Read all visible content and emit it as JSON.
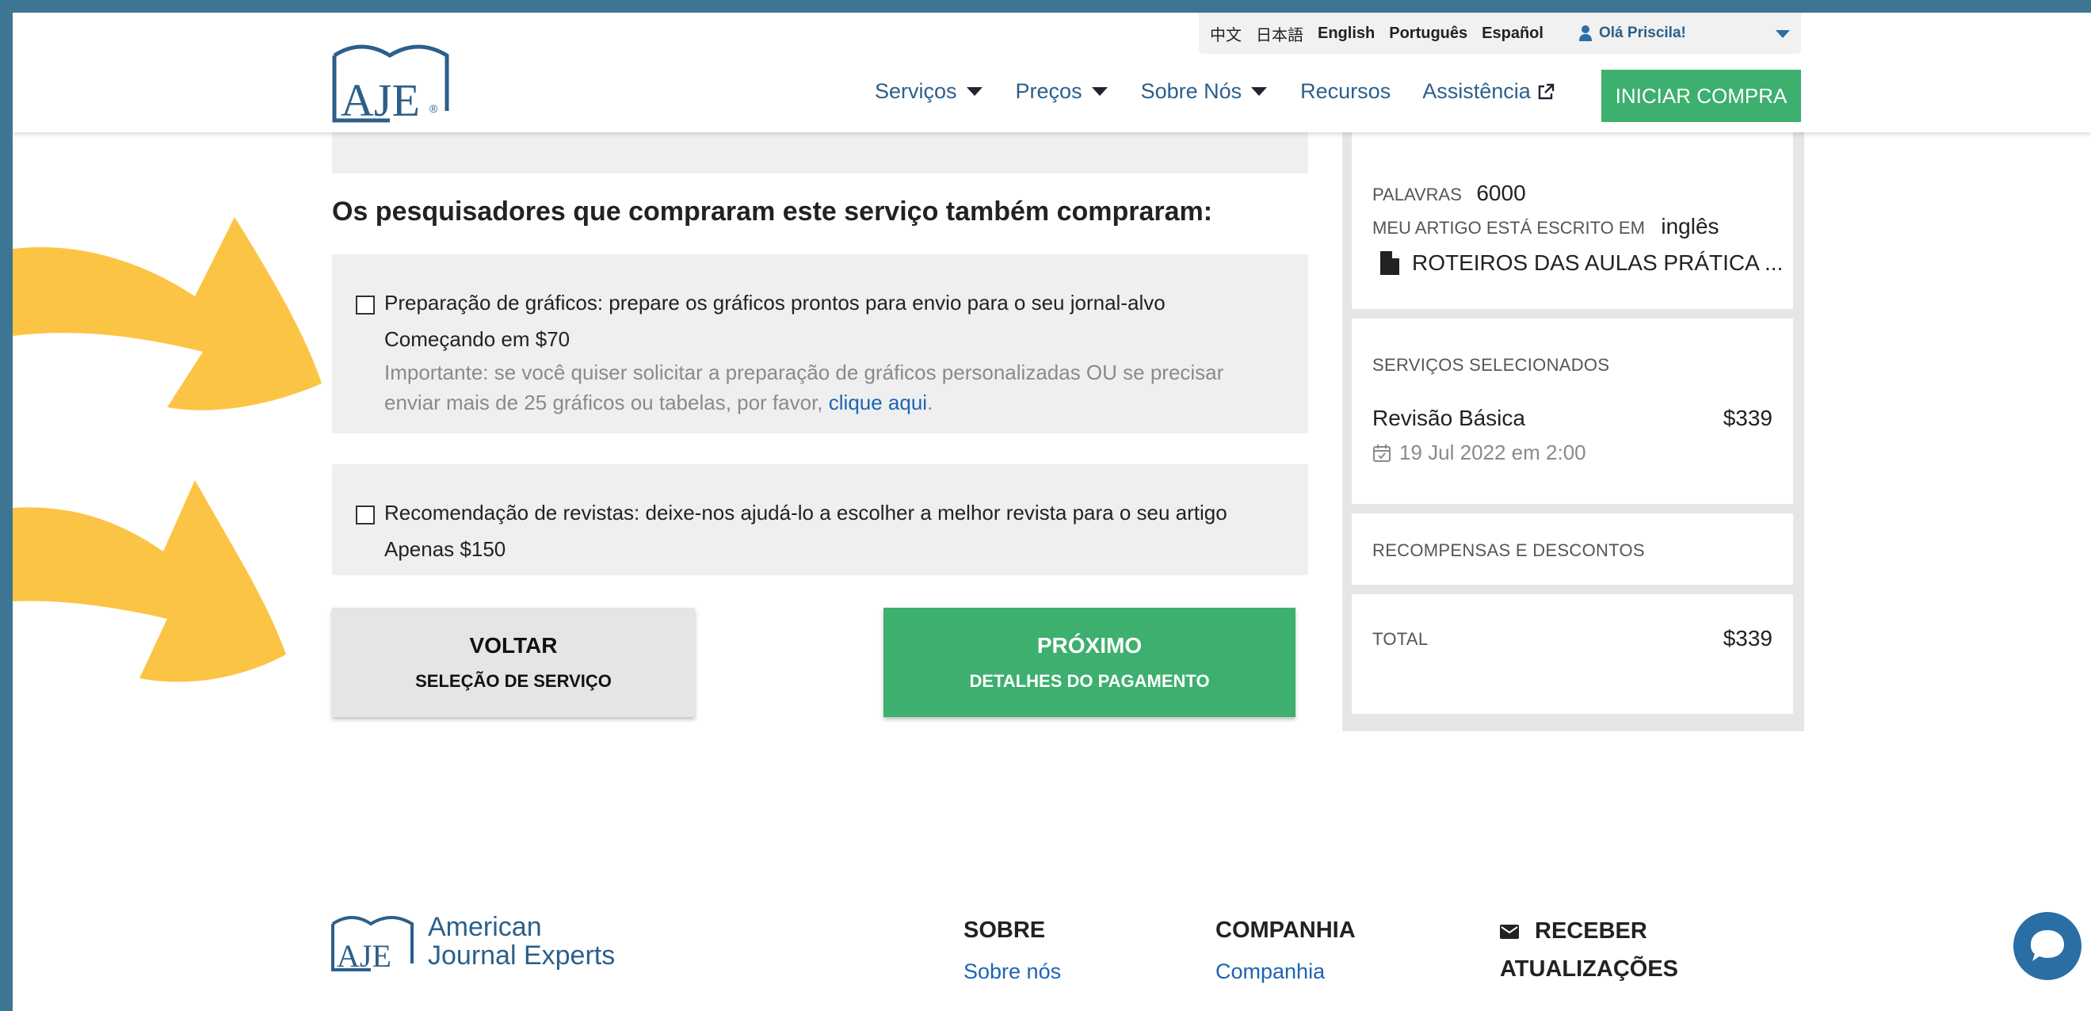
{
  "header": {
    "languages": [
      "中文",
      "日本語",
      "English",
      "Português",
      "Español"
    ],
    "user_greeting": "Olá Priscila!",
    "nav": [
      "Serviços",
      "Preços",
      "Sobre Nós",
      "Recursos",
      "Assistência"
    ],
    "cta": "INICIAR COMPRA"
  },
  "main": {
    "heading": "Os pesquisadores que compraram este serviço também compraram:",
    "option1": {
      "title": "Preparação de gráficos: prepare os gráficos prontos para envio para o seu jornal-alvo",
      "price": "Começando em $70",
      "note": "Importante: se você quiser solicitar a preparação de gráficos personalizadas OU se precisar enviar mais de 25 gráficos ou tabelas, por favor,",
      "note_link": "clique aqui",
      "note_end": "."
    },
    "option2": {
      "title": "Recomendação de revistas: deixe-nos ajudá-lo a escolher a melhor revista para o seu artigo",
      "price": "Apenas $150"
    },
    "back_button": {
      "line1": "VOLTAR",
      "line2": "SELEÇÃO DE SERVIÇO"
    },
    "next_button": {
      "line1": "PRÓXIMO",
      "line2": "DETALHES DO PAGAMENTO"
    }
  },
  "summary": {
    "words_label": "PALAVRAS",
    "words_value": "6000",
    "language_label": "MEU ARTIGO ESTÁ ESCRITO EM",
    "language_value": "inglês",
    "file_name": "ROTEIROS DAS AULAS PRÁTICA ...",
    "services_title": "SERVIÇOS SELECIONADOS",
    "service_name": "Revisão Básica",
    "service_price": "$339",
    "service_date": "19 Jul 2022 em 2:00",
    "rewards_title": "RECOMPENSAS E DESCONTOS",
    "total_label": "TOTAL",
    "total_value": "$339"
  },
  "footer": {
    "brand_line1": "American",
    "brand_line2": "Journal Experts",
    "col1_title": "SOBRE",
    "col1_link": "Sobre nós",
    "col2_title": "COMPANHIA",
    "col2_link": "Companhia",
    "col3_title_line1": "RECEBER",
    "col3_title_line2": "ATUALIZAÇÕES"
  },
  "colors": {
    "page_border": "#3d7593",
    "accent_green": "#3daf6e",
    "link_blue": "#1d64b3",
    "arrow_yellow": "#fcc445"
  },
  "icons": [
    "user-icon",
    "caret-down-icon",
    "external-link-icon",
    "document-icon",
    "calendar-icon",
    "envelope-icon",
    "chat-icon",
    "arrow-decoration"
  ]
}
